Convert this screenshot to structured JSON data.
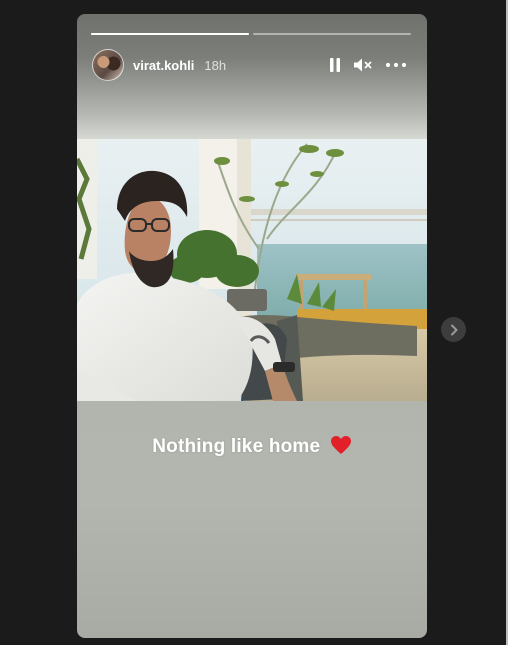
{
  "story": {
    "username": "virat.kohli",
    "time_ago": "18h",
    "caption_text": "Nothing like home",
    "caption_emoji": "❤️",
    "progress": [
      {
        "filled": 1.0
      },
      {
        "filled": 0.0
      }
    ],
    "controls": {
      "pause_icon": "pause-icon",
      "mute_icon": "speaker-muted-icon",
      "more_icon": "more-horizontal-icon"
    }
  },
  "navigation": {
    "next_icon": "chevron-right-icon"
  },
  "colors": {
    "page_background": "#1b1b1b",
    "heart": "#e1202a",
    "next_button": "#3d3d3d"
  }
}
